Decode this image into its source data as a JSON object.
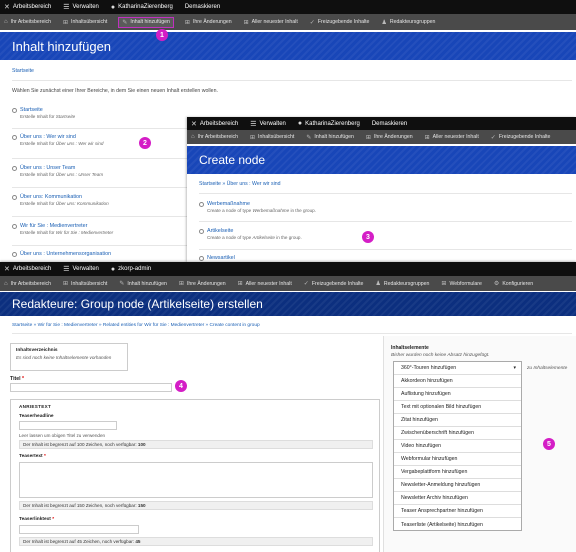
{
  "layer1": {
    "toolbar": [
      {
        "icon": "x-logo-icon",
        "label": "Arbeitsbereich"
      },
      {
        "icon": "hamburger-icon",
        "label": "Verwalten"
      },
      {
        "icon": "user-icon",
        "label": "KatharinaZierenberg"
      },
      {
        "icon": "",
        "label": "Demaskieren"
      }
    ],
    "tray": [
      {
        "icon": "home-icon",
        "label": "Ihr Arbeitsbereich"
      },
      {
        "icon": "sitemap-icon",
        "label": "Inhaltsübersicht"
      },
      {
        "icon": "pencil-icon",
        "label": "Inhalt hinzufügen",
        "active": true
      },
      {
        "icon": "sitemap-icon",
        "label": "Ihre Änderungen"
      },
      {
        "icon": "sitemap-icon",
        "label": "Aller neuester Inhalt"
      },
      {
        "icon": "check-icon",
        "label": "Freizugebende Inhalte"
      },
      {
        "icon": "group-icon",
        "label": "Redakteursgruppen"
      }
    ],
    "title": "Inhalt hinzufügen",
    "breadcrumb": "Startseite",
    "intro": "Wählen Sie zunächst einer Ihrer Bereiche, in dem Sie einen neuen Inhalt erstellen wollen.",
    "entries": [
      {
        "title": "Startseite",
        "desc_prefix": "Erstelle Inhalt für",
        "desc_target": "Startseite"
      },
      {
        "title": "Über uns : Wer wir sind",
        "desc_prefix": "Erstelle Inhalt für",
        "desc_target": "Über uns : Wer wir sind"
      },
      {
        "title": "Über uns : Unser Team",
        "desc_prefix": "Erstelle Inhalt für",
        "desc_target": "Über uns : Unser Team"
      },
      {
        "title": "Über uns: Kommunikation",
        "desc_prefix": "Erstelle Inhalt für",
        "desc_target": "Über uns: Kommunikation"
      },
      {
        "title": "Wir für Sie : Medienvertreter",
        "desc_prefix": "Erstelle Inhalt für",
        "desc_target": "Wir für Sie : Medienvertreter"
      },
      {
        "title": "Über uns : Unternehmensorganisation",
        "desc_prefix": "",
        "desc_target": ""
      }
    ]
  },
  "layer2": {
    "toolbar": [
      {
        "icon": "x-logo-icon",
        "label": "Arbeitsbereich"
      },
      {
        "icon": "hamburger-icon",
        "label": "Verwalten"
      },
      {
        "icon": "user-icon",
        "label": "KatharinaZierenberg"
      },
      {
        "icon": "",
        "label": "Demaskieren"
      }
    ],
    "tray": [
      {
        "icon": "home-icon",
        "label": "Ihr Arbeitsbereich"
      },
      {
        "icon": "sitemap-icon",
        "label": "Inhaltsübersicht"
      },
      {
        "icon": "pencil-icon",
        "label": "Inhalt hinzufügen"
      },
      {
        "icon": "sitemap-icon",
        "label": "Ihre Änderungen"
      },
      {
        "icon": "sitemap-icon",
        "label": "Aller neuester Inhalt"
      },
      {
        "icon": "check-icon",
        "label": "Freizugebende Inhalte"
      }
    ],
    "title": "Create node",
    "breadcrumb": "Startseite » Über uns : Wer wir sind",
    "entries": [
      {
        "title": "Werbemaßnahme",
        "desc_prefix": "Create a node of type",
        "desc_type": "Werbemaßnahme",
        "desc_suffix": "in the group."
      },
      {
        "title": "Artikelseite",
        "desc_prefix": "Create a node of type",
        "desc_type": "Artikelseite",
        "desc_suffix": "in the group."
      },
      {
        "title": "Newsartikel",
        "desc_prefix": "",
        "desc_type": "",
        "desc_suffix": ""
      }
    ]
  },
  "layer3": {
    "toolbar": [
      {
        "icon": "x-logo-icon",
        "label": "Arbeitsbereich"
      },
      {
        "icon": "hamburger-icon",
        "label": "Verwalten"
      },
      {
        "icon": "user-icon",
        "label": "zkorp-admin"
      }
    ],
    "tray": [
      {
        "icon": "home-icon",
        "label": "Ihr Arbeitsbereich"
      },
      {
        "icon": "sitemap-icon",
        "label": "Inhaltsübersicht"
      },
      {
        "icon": "pencil-icon",
        "label": "Inhalt hinzufügen"
      },
      {
        "icon": "sitemap-icon",
        "label": "Ihre Änderungen"
      },
      {
        "icon": "sitemap-icon",
        "label": "Aller neuester Inhalt"
      },
      {
        "icon": "check-icon",
        "label": "Freizugebende Inhalte"
      },
      {
        "icon": "group-icon",
        "label": "Redakteursgruppen"
      },
      {
        "icon": "sitemap-icon",
        "label": "Webformulare"
      },
      {
        "icon": "gear-icon",
        "label": "Konfigurieren"
      }
    ],
    "title": "Redakteure: Group node (Artikelseite) erstellen",
    "breadcrumb": "Startseite » Wir für Sie : Medienvertreter » Related entities for Wir für Sie : Medienvertreter » Create content in group",
    "inhaltsverzeichnis": {
      "label": "Inhaltsverzeichnis",
      "empty": "Es sind noch keine Inhaltselemente vorhanden"
    },
    "titel": {
      "label": "Titel",
      "value": ""
    },
    "anreisstext": {
      "legend": "ANRIESTEXT",
      "headline_label": "Teaserheadline",
      "headline_hint": "Leer lassen um obigen Titel zu verwenden",
      "headline_limit": "Der Inhalt ist begrenzt auf 100 Zeichen, noch verfügbar:",
      "headline_limit_num": "100",
      "text_label": "Teasertext",
      "text_limit": "Der Inhalt ist begrenzt auf 150 Zeichen, noch verfügbar:",
      "text_limit_num": "150",
      "link_label": "Teaserlinktext",
      "link_limit": "Der Inhalt ist begrenzt auf 45 Zeichen, noch verfügbar:",
      "link_limit_num": "45"
    },
    "inhaltselemente": {
      "label": "Inhaltselemente",
      "empty": "Bisher wurden noch keine Absatz hinzugefügt.",
      "suffix": "zu Inhaltselemente",
      "options": [
        "360°-Touren hinzufügen",
        "Akkordeon hinzufügen",
        "Auflistung hinzufügen",
        "Text mit optionalen Bild hinzufügen",
        "Zitat hinzufügen",
        "Zwischenüberschrift hinzufügen",
        "Video hinzufügen",
        "Webformular hinzufügen",
        "Vergabeplattform hinzufügen",
        "Newsletter-Anmeldung hinzufügen",
        "Newsletter Archiv hinzufügen",
        "Teaser Ansprechpartner hinzufügen",
        "Teaserliste (Artikelseite) hinzufügen"
      ]
    }
  },
  "badges": [
    "1",
    "2",
    "3",
    "4",
    "5"
  ],
  "colors": {
    "accent": "#d41ec6",
    "banner": "#1846b8",
    "toolbar": "#0f0f0f",
    "tray": "#4a4a4a",
    "link": "#1a5fb4"
  }
}
